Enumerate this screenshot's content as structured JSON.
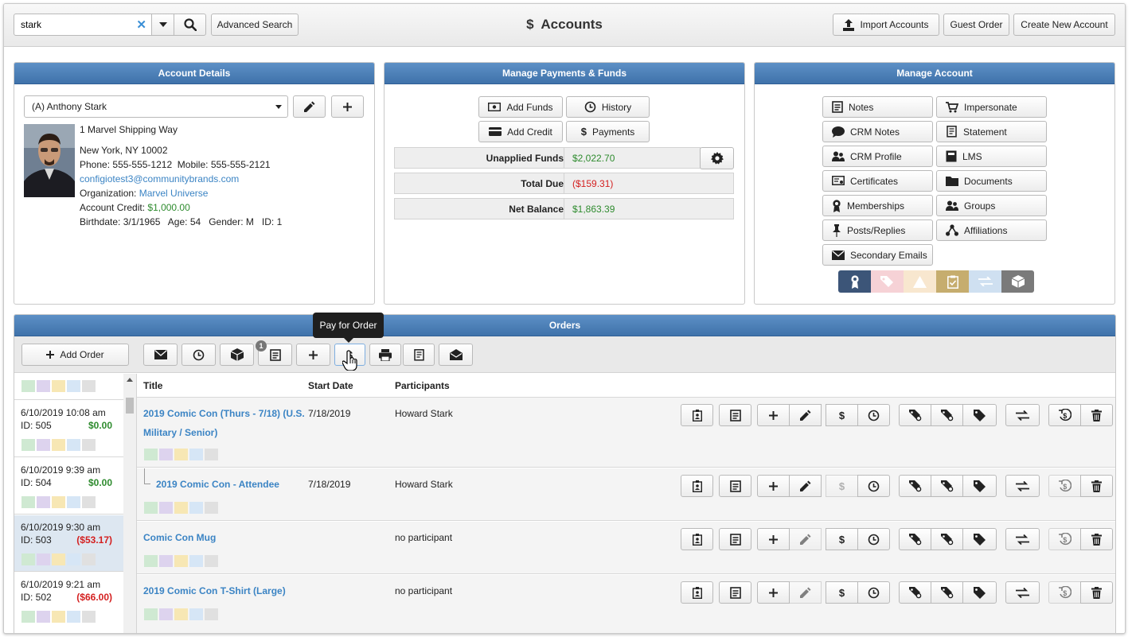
{
  "header": {
    "search_value": "stark",
    "advanced_search": "Advanced Search",
    "title": "Accounts",
    "title_symbol": "$",
    "import_accounts": "Import Accounts",
    "guest_order": "Guest Order",
    "create_new_account": "Create New Account"
  },
  "account_details": {
    "heading": "Account Details",
    "selected_account": "(A) Anthony Stark",
    "address1": "1 Marvel Shipping Way",
    "address2": "New York, NY 10002",
    "phone_label": "Phone:",
    "phone": "555-555-1212",
    "mobile_label": "Mobile:",
    "mobile": "555-555-2121",
    "email": "configiotest3@communitybrands.com",
    "org_label": "Organization:",
    "organization": "Marvel Universe",
    "credit_label": "Account Credit:",
    "credit": "$1,000.00",
    "birthdate_label": "Birthdate:",
    "birthdate": "3/1/1965",
    "age_label": "Age:",
    "age": "54",
    "gender_label": "Gender:",
    "gender": "M",
    "id_label": "ID:",
    "id": "1"
  },
  "payments": {
    "heading": "Manage Payments & Funds",
    "add_funds": "Add Funds",
    "history": "History",
    "add_credit": "Add Credit",
    "payments": "Payments",
    "rows": [
      {
        "label": "Unapplied Funds",
        "value": "$2,022.70",
        "color": "#2e8b2e"
      },
      {
        "label": "Total Due",
        "value": "($159.31)",
        "color": "#d42020"
      },
      {
        "label": "Net Balance",
        "value": "$1,863.39",
        "color": "#2e8b2e"
      }
    ]
  },
  "manage_account": {
    "heading": "Manage Account",
    "buttons": [
      "Notes",
      "Impersonate",
      "CRM Notes",
      "Statement",
      "CRM Profile",
      "LMS",
      "Certificates",
      "Documents",
      "Memberships",
      "Groups",
      "Posts/Replies",
      "Affiliations",
      "Secondary Emails"
    ],
    "swatch_colors": [
      "#3c5578",
      "#f6d2d6",
      "#f8e7cf",
      "#c6ad6e",
      "#cfe0f1",
      "#7a7a7a"
    ]
  },
  "orders": {
    "heading": "Orders",
    "add_order": "Add Order",
    "tooltip": "Pay for Order",
    "notes_badge": "1",
    "columns": {
      "title": "Title",
      "start_date": "Start Date",
      "participants": "Participants"
    },
    "sidebar": [
      {
        "date": "6/10/2019 10:08 am",
        "id": "ID: 505",
        "amount": "$0.00",
        "color": "#2e8b2e"
      },
      {
        "date": "6/10/2019 9:39 am",
        "id": "ID: 504",
        "amount": "$0.00",
        "color": "#2e8b2e"
      },
      {
        "date": "6/10/2019 9:30 am",
        "id": "ID: 503",
        "amount": "($53.17)",
        "color": "#d42020"
      },
      {
        "date": "6/10/2019 9:21 am",
        "id": "ID: 502",
        "amount": "($66.00)",
        "color": "#d42020"
      }
    ],
    "rows": [
      {
        "title_line1": "2019 Comic Con (Thurs - 7/18) (U.S.",
        "title_line2": "Military / Senior)",
        "start_date": "7/18/2019",
        "participants": "Howard Stark"
      },
      {
        "title_line1": "2019 Comic Con - Attendee",
        "title_line2": "",
        "start_date": "7/18/2019",
        "participants": "Howard Stark"
      },
      {
        "title_line1": "Comic Con Mug",
        "title_line2": "",
        "start_date": "",
        "participants": "no participant"
      },
      {
        "title_line1": "2019 Comic Con T-Shirt (Large)",
        "title_line2": "",
        "start_date": "",
        "participants": "no participant"
      }
    ]
  }
}
